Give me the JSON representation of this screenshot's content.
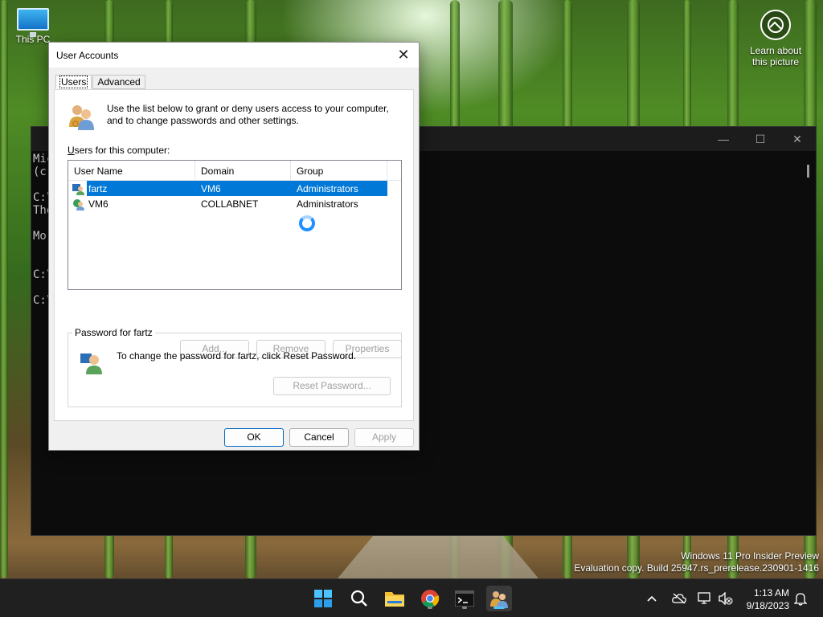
{
  "desktop": {
    "this_pc_label": "This PC",
    "learn_label_1": "Learn about",
    "learn_label_2": "this picture"
  },
  "terminal": {
    "lines": [
      "Mic",
      "(c)",
      "",
      "C:\\",
      "The",
      "",
      "Mor",
      "",
      "",
      "C:\\",
      "",
      "C:\\"
    ]
  },
  "dialog": {
    "title": "User Accounts",
    "close_glyph": "✕",
    "tabs": [
      {
        "label": "Users",
        "active": true
      },
      {
        "label": "Advanced",
        "active": false
      }
    ],
    "intro_text": "Use the list below to grant or deny users access to your computer, and to change passwords and other settings.",
    "users_label_u": "U",
    "users_label_rest": "sers for this computer:",
    "columns": [
      "User Name",
      "Domain",
      "Group"
    ],
    "rows": [
      {
        "name": "fartz",
        "domain": "VM6",
        "group": "Administrators",
        "selected": true
      },
      {
        "name": "VM6",
        "domain": "COLLABNET",
        "group": "Administrators",
        "selected": false
      }
    ],
    "buttons": {
      "add": "Add...",
      "remove": "Remove",
      "properties": "Properties",
      "reset_password": "Reset Password...",
      "ok": "OK",
      "cancel": "Cancel",
      "apply": "Apply"
    },
    "password_group_title": "Password for fartz",
    "password_text": "To change the password for fartz, click Reset Password."
  },
  "watermark": {
    "line1": "Windows 11 Pro Insider Preview",
    "line2": "Evaluation copy. Build 25947.rs_prerelease.230901-1416"
  },
  "taskbar": {
    "apps": [
      "start-icon",
      "search-icon",
      "file-explorer-icon",
      "chrome-icon",
      "terminal-icon",
      "user-accounts-icon"
    ],
    "time": "1:13 AM",
    "date": "9/18/2023"
  },
  "colors": {
    "accent": "#0078d7",
    "taskbar": "#202020",
    "dialog_bg": "#f0f0f0"
  }
}
